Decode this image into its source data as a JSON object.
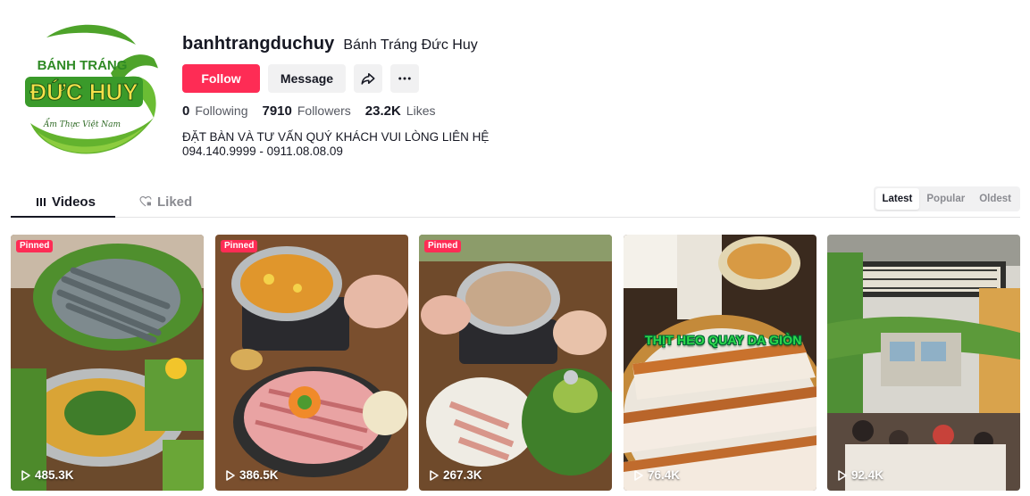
{
  "profile": {
    "username": "banhtrangduchuy",
    "nickname": "Bánh Tráng Đức Huy",
    "logo": {
      "line1": "BÁNH TRÁNG",
      "line2": "ĐỨC HUY",
      "tagline": "Ẩm Thực Việt Nam",
      "brand_green": "#3a9a2a",
      "brand_yellow": "#f6e04a"
    },
    "follow_label": "Follow",
    "message_label": "Message",
    "share_icon": "share-icon",
    "more_icon": "more-icon",
    "stats": {
      "following_count": "0",
      "following_label": "Following",
      "followers_count": "7910",
      "followers_label": "Followers",
      "likes_count": "23.2K",
      "likes_label": "Likes"
    },
    "bio": "ĐẶT BÀN VÀ TƯ VẤN QUÝ KHÁCH VUI LÒNG LIÊN HỆ 094.140.9999 - 0911.08.08.09"
  },
  "tabs": {
    "videos_label": "Videos",
    "liked_label": "Liked",
    "active": "Videos"
  },
  "sort": {
    "latest": "Latest",
    "popular": "Popular",
    "oldest": "Oldest",
    "active": "Latest"
  },
  "videos": [
    {
      "views": "485.3K",
      "pinned": true,
      "pinned_label": "Pinned"
    },
    {
      "views": "386.5K",
      "pinned": true,
      "pinned_label": "Pinned"
    },
    {
      "views": "267.3K",
      "pinned": true,
      "pinned_label": "Pinned"
    },
    {
      "views": "76.4K",
      "pinned": false,
      "caption": "THỊT HEO QUAY DA GIÒN"
    },
    {
      "views": "92.4K",
      "pinned": false
    }
  ],
  "colors": {
    "accent": "#fe2c55",
    "text": "#161823",
    "muted": "#8a8b91",
    "button_bg": "#f1f1f2"
  }
}
